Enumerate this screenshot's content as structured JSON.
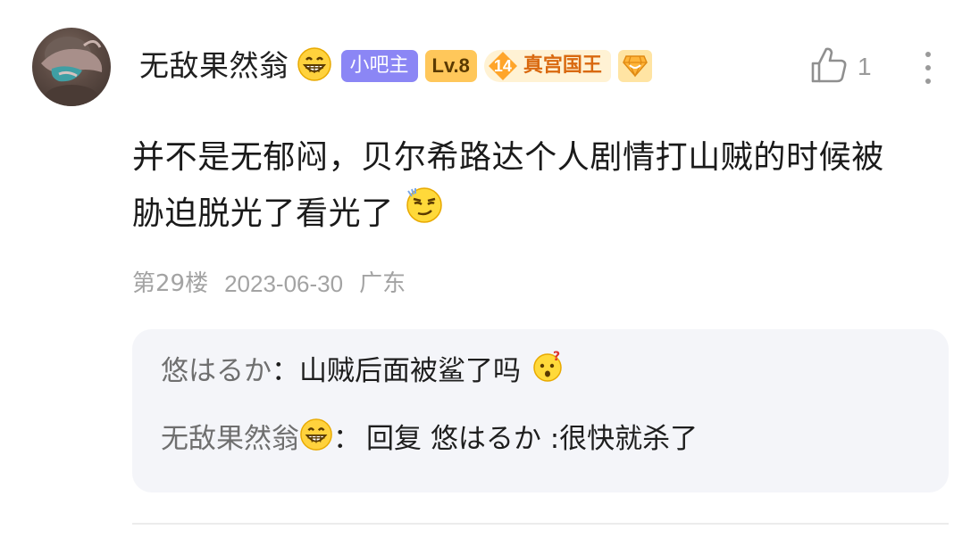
{
  "post": {
    "username": "无敌果然翁",
    "badges": {
      "bazhu": "小吧主",
      "level": "Lv.8",
      "title_level": "14",
      "title_name": "真宫国王"
    },
    "like_count": "1",
    "content_line1": "并不是无郁闷，贝尔希路达个人剧情打山贼的时候被",
    "content_line2": "胁迫脱光了看光了",
    "floor": "第29楼",
    "date": "2023-06-30",
    "location": "广东"
  },
  "replies": [
    {
      "author": "悠はるか",
      "sep": "：",
      "text": "山贼后面被鲨了吗"
    },
    {
      "author": "无敌果然翁",
      "sep": "：",
      "text": "回复 悠はるか :很快就杀了"
    }
  ],
  "icons": {
    "grin_emoji": "grinning-face-icon",
    "smug_emoji": "smug-face-icon",
    "question_emoji": "confused-face-icon",
    "gem": "gem-icon",
    "like": "thumbs-up-icon",
    "more": "more-vertical-icon"
  },
  "colors": {
    "bazhu_badge": "#8b86f5",
    "level_badge": "#ffc75a",
    "title_badge_bg": "#fff2d4",
    "title_text": "#d9690f",
    "reply_bg": "#f4f5f9",
    "meta_text": "#a3a3a3"
  }
}
